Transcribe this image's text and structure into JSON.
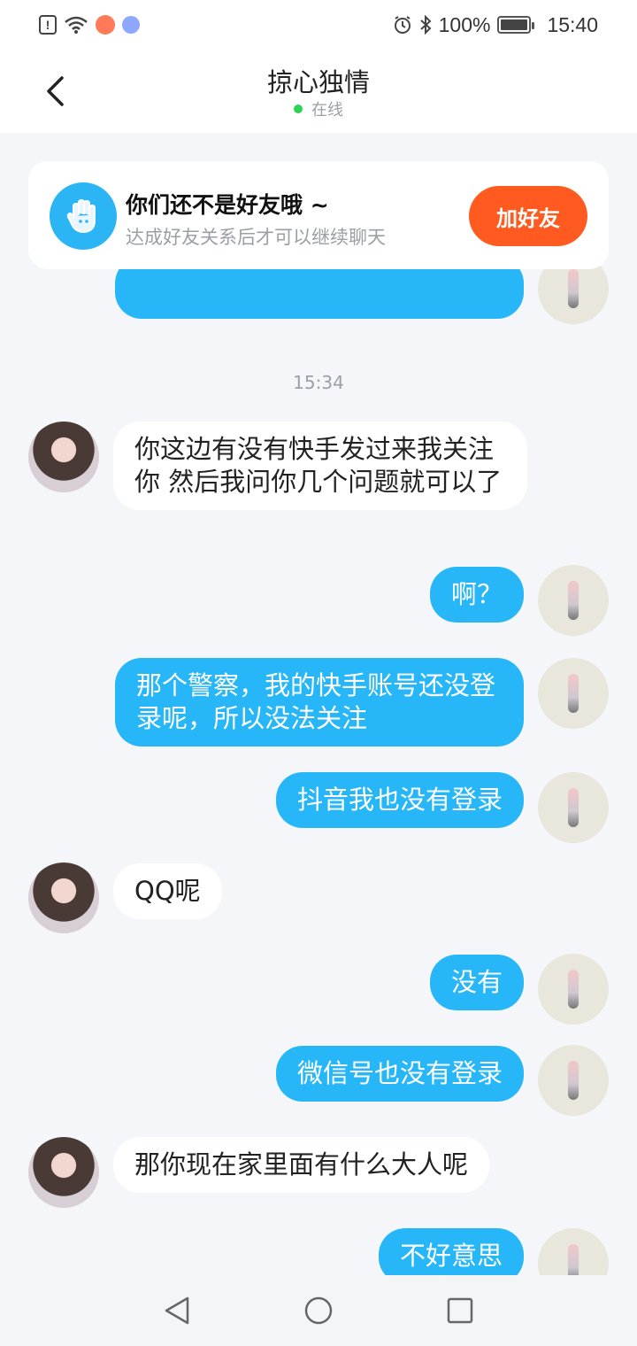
{
  "status_bar": {
    "battery": "100%",
    "time": "15:40"
  },
  "header": {
    "title": "掠心独情",
    "status": "在线"
  },
  "banner": {
    "title": "你们还不是好友哦 ~",
    "subtitle": "达成好友关系后才可以继续聊天",
    "button": "加好友"
  },
  "messages": {
    "time_1534": "15:34",
    "m1": "你这边有没有快手发过来我关注你 然后我问你几个问题就可以了",
    "m2": "啊？",
    "m3": "那个警察，我的快手账号还没登录呢，所以没法关注",
    "m4": "抖音我也没有登录",
    "m5": "QQ呢",
    "m6": "没有",
    "m7": "微信号也没有登录",
    "m8": "那你现在家里面有什么大人呢",
    "m9": "不好意思"
  },
  "colors": {
    "accent_blue": "#27b7f8",
    "add_friend_orange": "#ff5a1f",
    "online_green": "#2fd158"
  }
}
